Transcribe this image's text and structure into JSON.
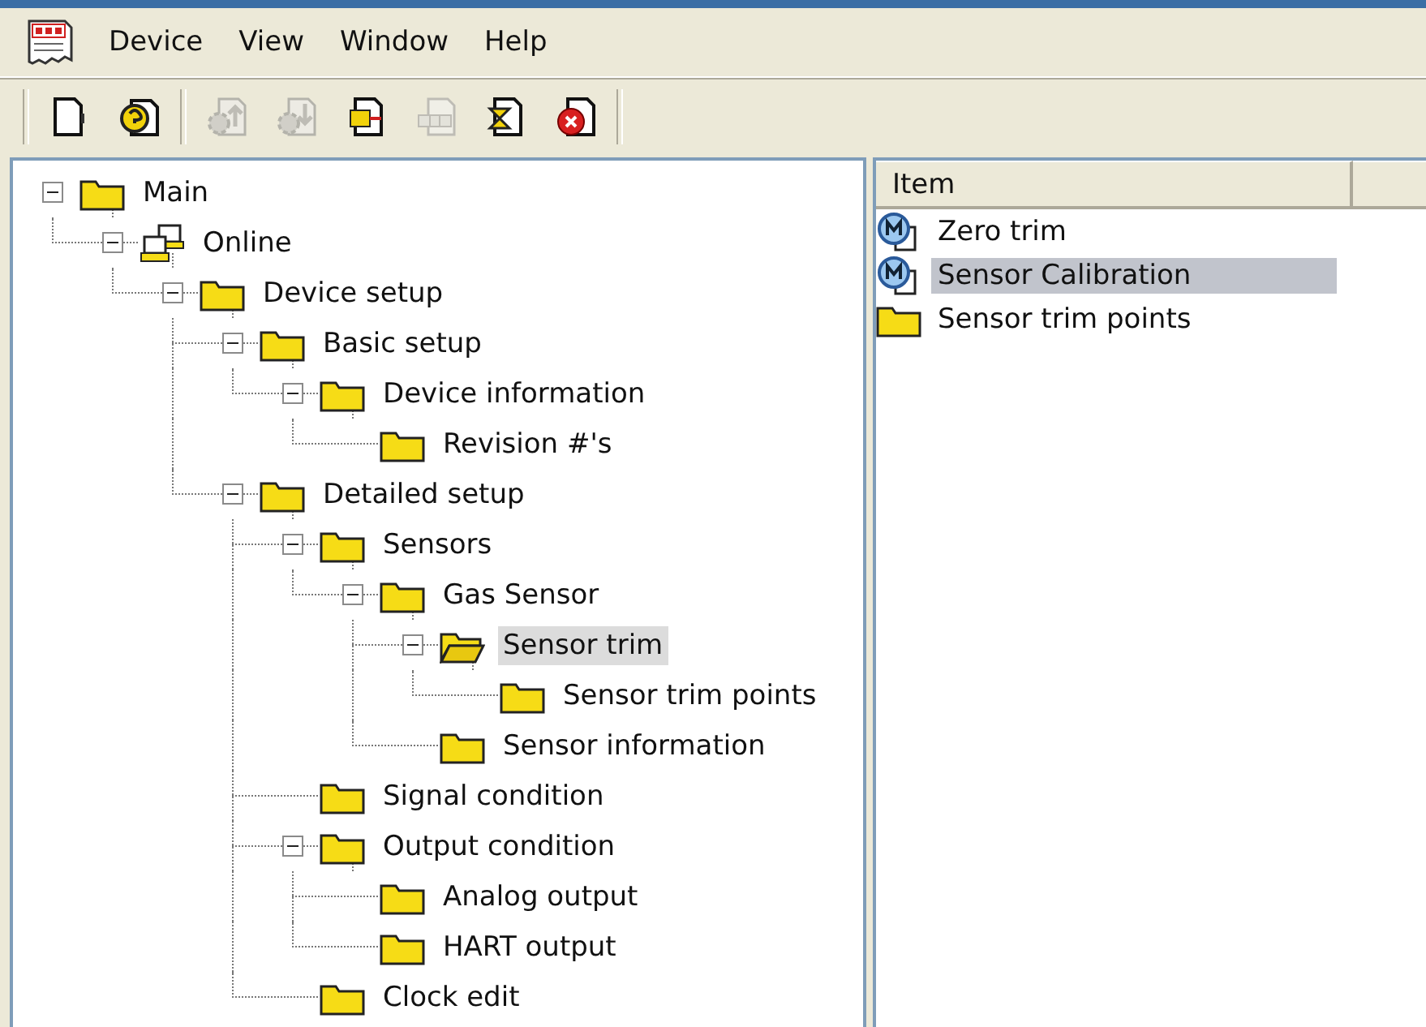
{
  "menu": [
    "Device",
    "View",
    "Window",
    "Help"
  ],
  "toolbar": [
    [
      {
        "kind": "new",
        "disabled": false
      },
      {
        "kind": "help",
        "disabled": false
      }
    ],
    [
      {
        "kind": "upload",
        "disabled": true
      },
      {
        "kind": "download",
        "disabled": true
      },
      {
        "kind": "export",
        "disabled": false
      },
      {
        "kind": "grid",
        "disabled": true
      },
      {
        "kind": "wait",
        "disabled": false
      },
      {
        "kind": "stop",
        "disabled": false
      }
    ]
  ],
  "tree": [
    {
      "label": "Main",
      "kind": "folder",
      "expanded": true,
      "selected": false,
      "children": [
        {
          "label": "Online",
          "kind": "online",
          "expanded": true,
          "selected": false,
          "children": [
            {
              "label": "Device setup",
              "kind": "folder",
              "expanded": true,
              "selected": false,
              "children": [
                {
                  "label": "Basic setup",
                  "kind": "folder",
                  "expanded": true,
                  "selected": false,
                  "children": [
                    {
                      "label": "Device information",
                      "kind": "folder",
                      "expanded": true,
                      "selected": false,
                      "children": [
                        {
                          "label": "Revision #'s",
                          "kind": "folder",
                          "selected": false
                        }
                      ]
                    }
                  ]
                },
                {
                  "label": "Detailed setup",
                  "kind": "folder",
                  "expanded": true,
                  "selected": false,
                  "children": [
                    {
                      "label": "Sensors",
                      "kind": "folder",
                      "expanded": true,
                      "selected": false,
                      "children": [
                        {
                          "label": "Gas Sensor",
                          "kind": "folder",
                          "expanded": true,
                          "selected": false,
                          "children": [
                            {
                              "label": "Sensor trim",
                              "kind": "folder",
                              "expanded": true,
                              "selected": true,
                              "children": [
                                {
                                  "label": "Sensor trim points",
                                  "kind": "folder",
                                  "selected": false
                                }
                              ]
                            },
                            {
                              "label": "Sensor information",
                              "kind": "folder",
                              "selected": false
                            }
                          ]
                        }
                      ]
                    },
                    {
                      "label": "Signal condition",
                      "kind": "folder",
                      "selected": false
                    },
                    {
                      "label": "Output condition",
                      "kind": "folder",
                      "expanded": true,
                      "selected": false,
                      "children": [
                        {
                          "label": "Analog output",
                          "kind": "folder",
                          "selected": false
                        },
                        {
                          "label": "HART output",
                          "kind": "folder",
                          "selected": false
                        }
                      ]
                    },
                    {
                      "label": "Clock edit",
                      "kind": "folder",
                      "selected": false
                    }
                  ]
                }
              ]
            }
          ]
        }
      ]
    }
  ],
  "list": {
    "columns": [
      "Item"
    ],
    "items": [
      {
        "label": "Zero trim",
        "kind": "method",
        "selected": false
      },
      {
        "label": "Sensor Calibration",
        "kind": "method",
        "selected": true
      },
      {
        "label": "Sensor trim points",
        "kind": "folder",
        "selected": false
      }
    ]
  }
}
